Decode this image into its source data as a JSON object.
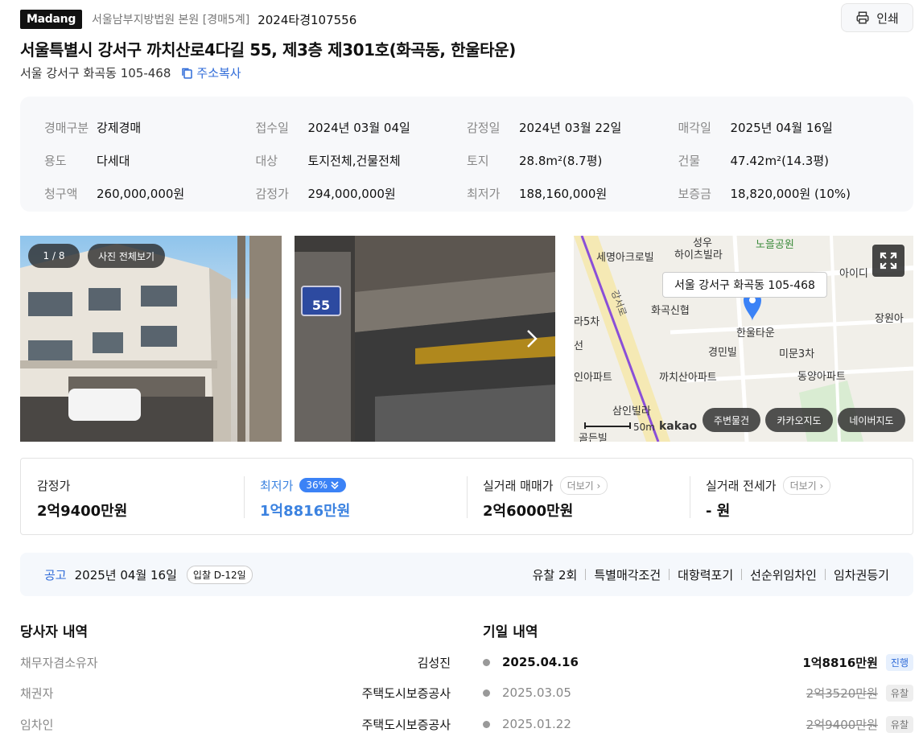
{
  "header": {
    "brand": "Madang",
    "court": "서울남부지방법원 본원 [경매5계]",
    "case_no": "2024타경107556",
    "print_label": "인쇄"
  },
  "title": "서울특별시 강서구 까치산로4다길 55, 제3층 제301호(화곡동, 한울타운)",
  "lot_address": "서울 강서구 화곡동 105-468",
  "copy_label": "주소복사",
  "info": [
    {
      "k": "경매구분",
      "v": "강제경매"
    },
    {
      "k": "접수일",
      "v": "2024년 03월 04일"
    },
    {
      "k": "감정일",
      "v": "2024년 03월 22일"
    },
    {
      "k": "매각일",
      "v": "2025년 04월 16일"
    },
    {
      "k": "용도",
      "v": "다세대"
    },
    {
      "k": "대상",
      "v": "토지전체,건물전체"
    },
    {
      "k": "토지",
      "v": "28.8m²(8.7평)"
    },
    {
      "k": "건물",
      "v": "47.42m²(14.3평)"
    },
    {
      "k": "청구액",
      "v": "260,000,000원"
    },
    {
      "k": "감정가",
      "v": "294,000,000원"
    },
    {
      "k": "최저가",
      "v": "188,160,000원"
    },
    {
      "k": "보증금",
      "v": "18,820,000원 (10%)"
    }
  ],
  "photos": {
    "counter": "1 / 8",
    "view_all": "사진 전체보기",
    "sign_number": "55"
  },
  "map": {
    "address_bubble": "서울 강서구 화곡동 105-468",
    "labels": [
      "성우",
      "노을공원",
      "세명아크로빌",
      "하이츠빌라",
      "아이디",
      "화곡신협",
      "한울타운",
      "장원아",
      "라5차",
      "경민빌",
      "미문3차",
      "선",
      "인아파트",
      "까치산아파트",
      "동양아파트",
      "삼인빌라",
      "골든빌",
      "강서로"
    ],
    "scale": "50m",
    "logo": "kakao",
    "buttons": [
      "주변물건",
      "카카오지도",
      "네이버지도"
    ]
  },
  "summary": [
    {
      "label": "감정가",
      "value": "2억9400만원"
    },
    {
      "label": "최저가",
      "badge": "36%",
      "value": "1억8816만원"
    },
    {
      "label": "실거래 매매가",
      "more": "더보기",
      "value": "2억6000만원"
    },
    {
      "label": "실거래 전세가",
      "more": "더보기",
      "value": "- 원"
    }
  ],
  "notice": {
    "tag": "공고",
    "date": "2025년 04월 16일",
    "dday": "입찰 D-12일",
    "flags": [
      "유찰 2회",
      "특별매각조건",
      "대항력포기",
      "선순위임차인",
      "임차권등기"
    ]
  },
  "parties": {
    "title": "당사자 내역",
    "rows": [
      {
        "k": "채무자겸소유자",
        "v": "김성진"
      },
      {
        "k": "채권자",
        "v": "주택도시보증공사"
      },
      {
        "k": "임차인",
        "v": "주택도시보증공사"
      }
    ]
  },
  "history": {
    "title": "기일 내역",
    "rows": [
      {
        "date": "2025.04.16",
        "price": "1억8816만원",
        "status": "진행"
      },
      {
        "date": "2025.03.05",
        "price": "2억3520만원",
        "status": "유찰"
      },
      {
        "date": "2025.01.22",
        "price": "2억9400만원",
        "status": "유찰"
      }
    ]
  }
}
